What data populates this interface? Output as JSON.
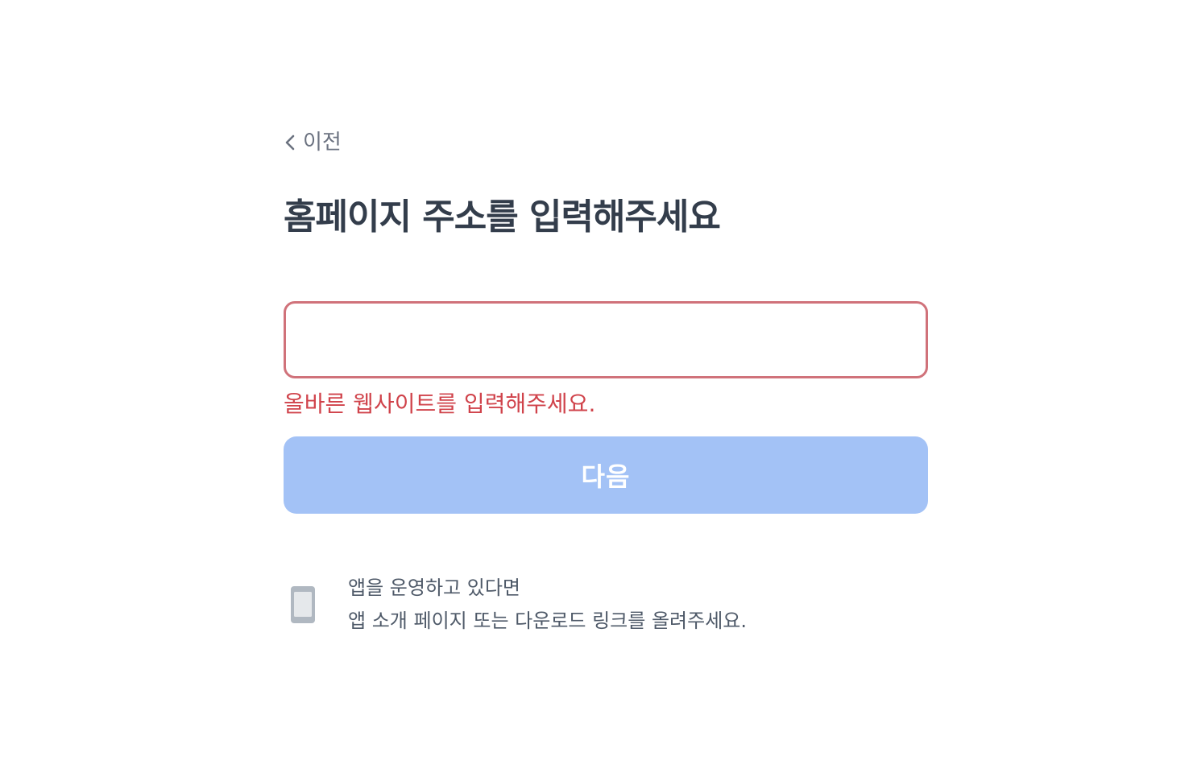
{
  "back": {
    "label": "이전"
  },
  "title": "홈페이지 주소를 입력해주세요",
  "url_input": {
    "value": "",
    "placeholder": ""
  },
  "error_message": "올바른 웹사이트를 입력해주세요.",
  "next_button": {
    "label": "다음"
  },
  "app_note": {
    "icon": "phone-icon",
    "line1": "앱을 운영하고 있다면",
    "line2": "앱 소개 페이지 또는 다운로드 링크를 올려주세요."
  },
  "colors": {
    "title": "#333d4b",
    "error": "#d0434b",
    "input_border_error": "#d0727a",
    "button_disabled": "#a3c2f6",
    "secondary_text": "#6b7280",
    "icon_gray": "#b0b8c1"
  }
}
